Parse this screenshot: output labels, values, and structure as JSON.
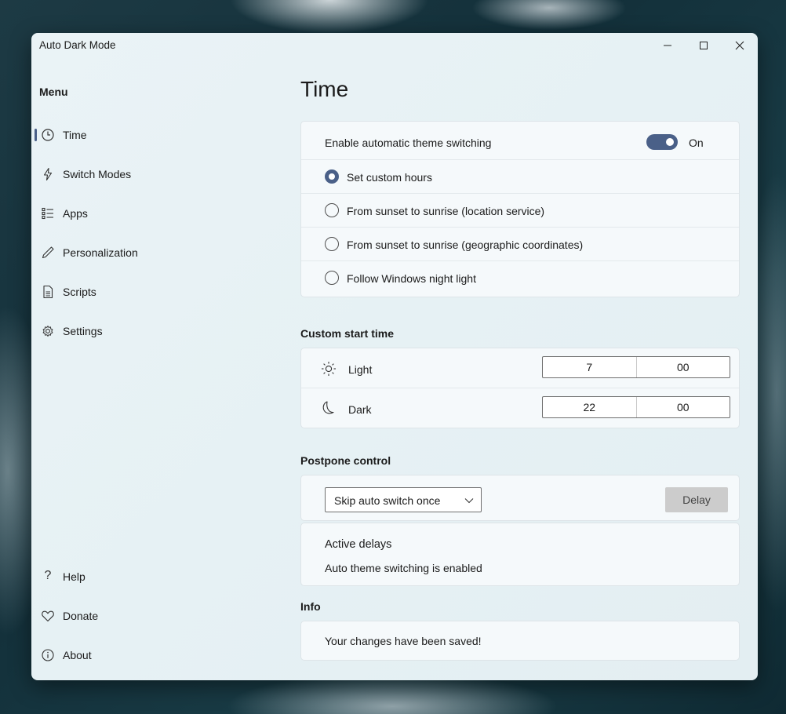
{
  "window": {
    "title": "Auto Dark Mode"
  },
  "sidebar": {
    "menu_title": "Menu",
    "items": [
      {
        "label": "Time",
        "icon": "clock-icon",
        "active": true
      },
      {
        "label": "Switch Modes",
        "icon": "lightning-icon"
      },
      {
        "label": "Apps",
        "icon": "list-icon"
      },
      {
        "label": "Personalization",
        "icon": "pen-icon"
      },
      {
        "label": "Scripts",
        "icon": "document-icon"
      },
      {
        "label": "Settings",
        "icon": "gear-icon"
      }
    ],
    "footer_items": [
      {
        "label": "Help",
        "icon": "question-icon"
      },
      {
        "label": "Donate",
        "icon": "heart-icon"
      },
      {
        "label": "About",
        "icon": "info-icon"
      }
    ]
  },
  "page": {
    "title": "Time",
    "auto_switch": {
      "label": "Enable automatic theme switching",
      "state_label": "On",
      "enabled": true
    },
    "modes": [
      {
        "label": "Set custom hours",
        "selected": true
      },
      {
        "label": "From sunset to sunrise (location service)",
        "selected": false
      },
      {
        "label": "From sunset to sunrise (geographic coordinates)",
        "selected": false
      },
      {
        "label": "Follow Windows night light",
        "selected": false
      }
    ],
    "custom_start": {
      "heading": "Custom start time",
      "light": {
        "label": "Light",
        "icon": "sun-icon",
        "hour": "7",
        "minute": "00"
      },
      "dark": {
        "label": "Dark",
        "icon": "moon-icon",
        "hour": "22",
        "minute": "00"
      }
    },
    "postpone": {
      "heading": "Postpone control",
      "selected_option": "Skip auto switch once",
      "delay_label": "Delay",
      "active_delays_title": "Active delays",
      "active_delays_text": "Auto theme switching is enabled"
    },
    "info": {
      "heading": "Info",
      "message": "Your changes have been saved!"
    }
  },
  "colors": {
    "accent": "#4a6088",
    "window_bg": "#e6f1f4",
    "card_bg": "#f5f9fb"
  }
}
